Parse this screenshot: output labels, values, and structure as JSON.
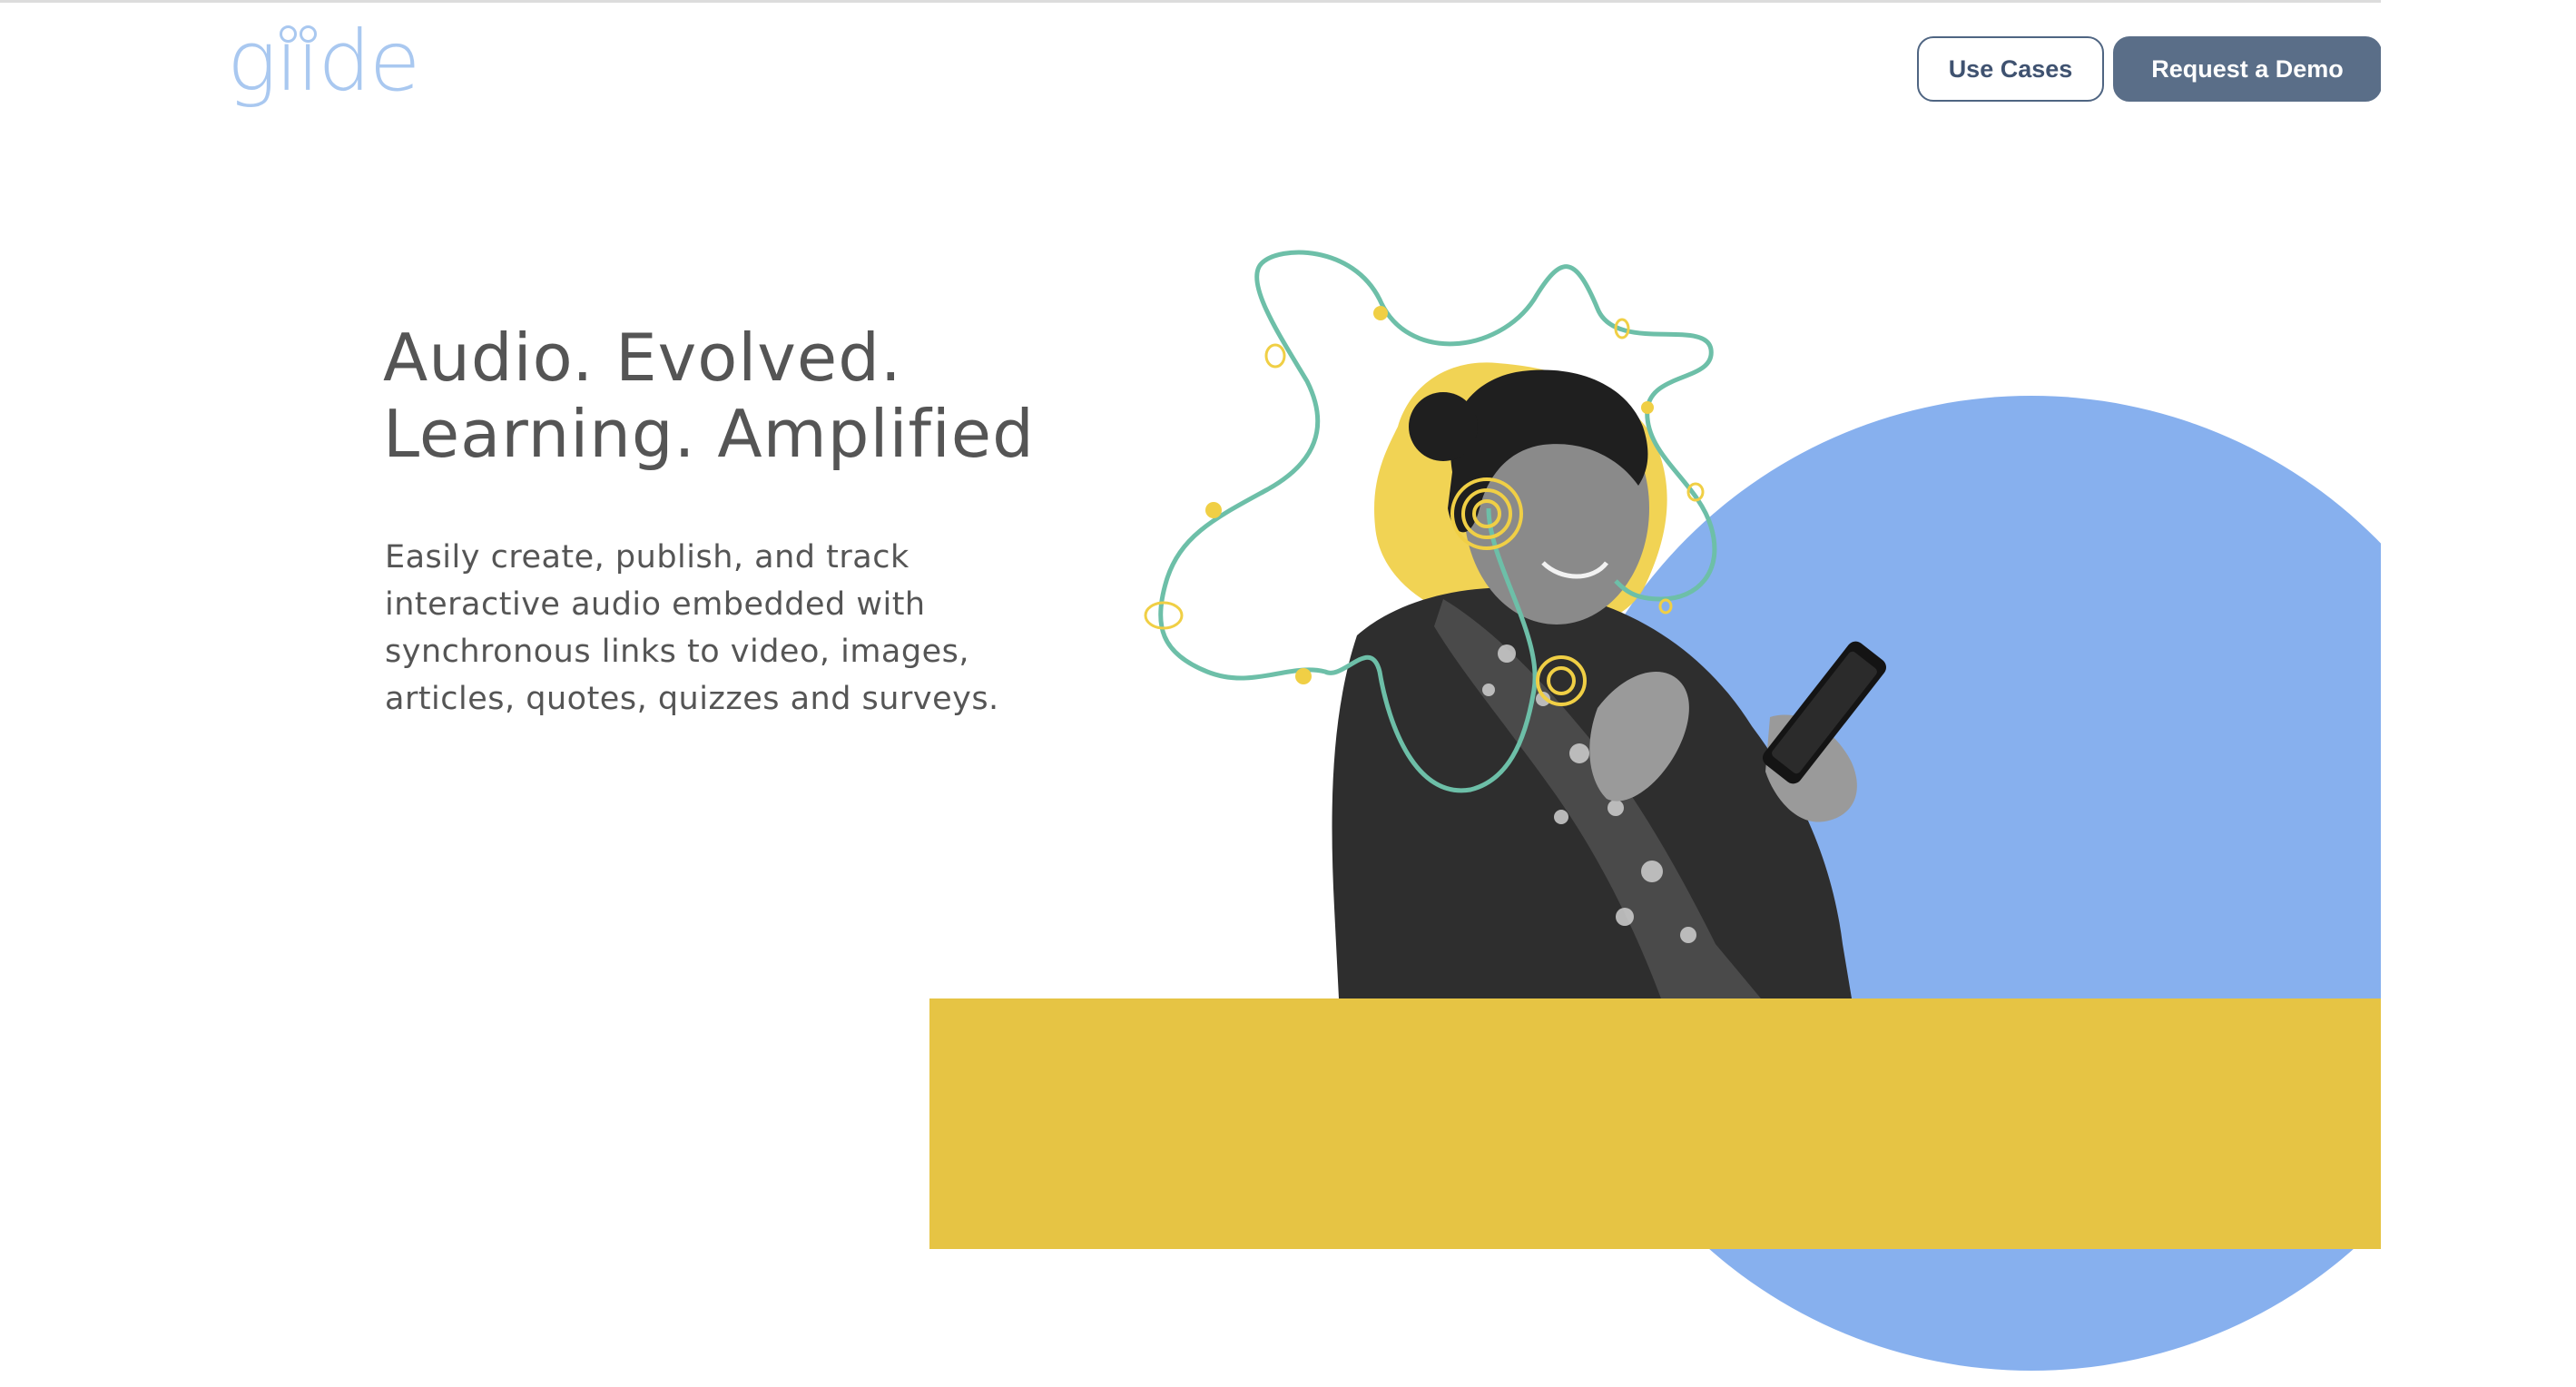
{
  "header": {
    "logo_text": "giide",
    "nav": {
      "use_cases_label": "Use Cases",
      "request_demo_label": "Request a Demo"
    }
  },
  "hero": {
    "headline_line1": "Audio. Evolved.",
    "headline_line2": "Learning. Amplified",
    "description": "Easily create, publish, and track interactive audio embedded with synchronous links to video, images, articles, quotes, quizzes and surveys.",
    "image": "woman-listening-to-phone-audio-illustration"
  },
  "colors": {
    "logo": "#a9c8f0",
    "button_outline": "#4f6582",
    "button_solid": "#5a6e88",
    "text": "#555555",
    "blue_circle": "#87b0ee",
    "yellow_band": "#e6c444",
    "squiggle": "#6dbfa8",
    "yellow_accent": "#f0cf45"
  }
}
